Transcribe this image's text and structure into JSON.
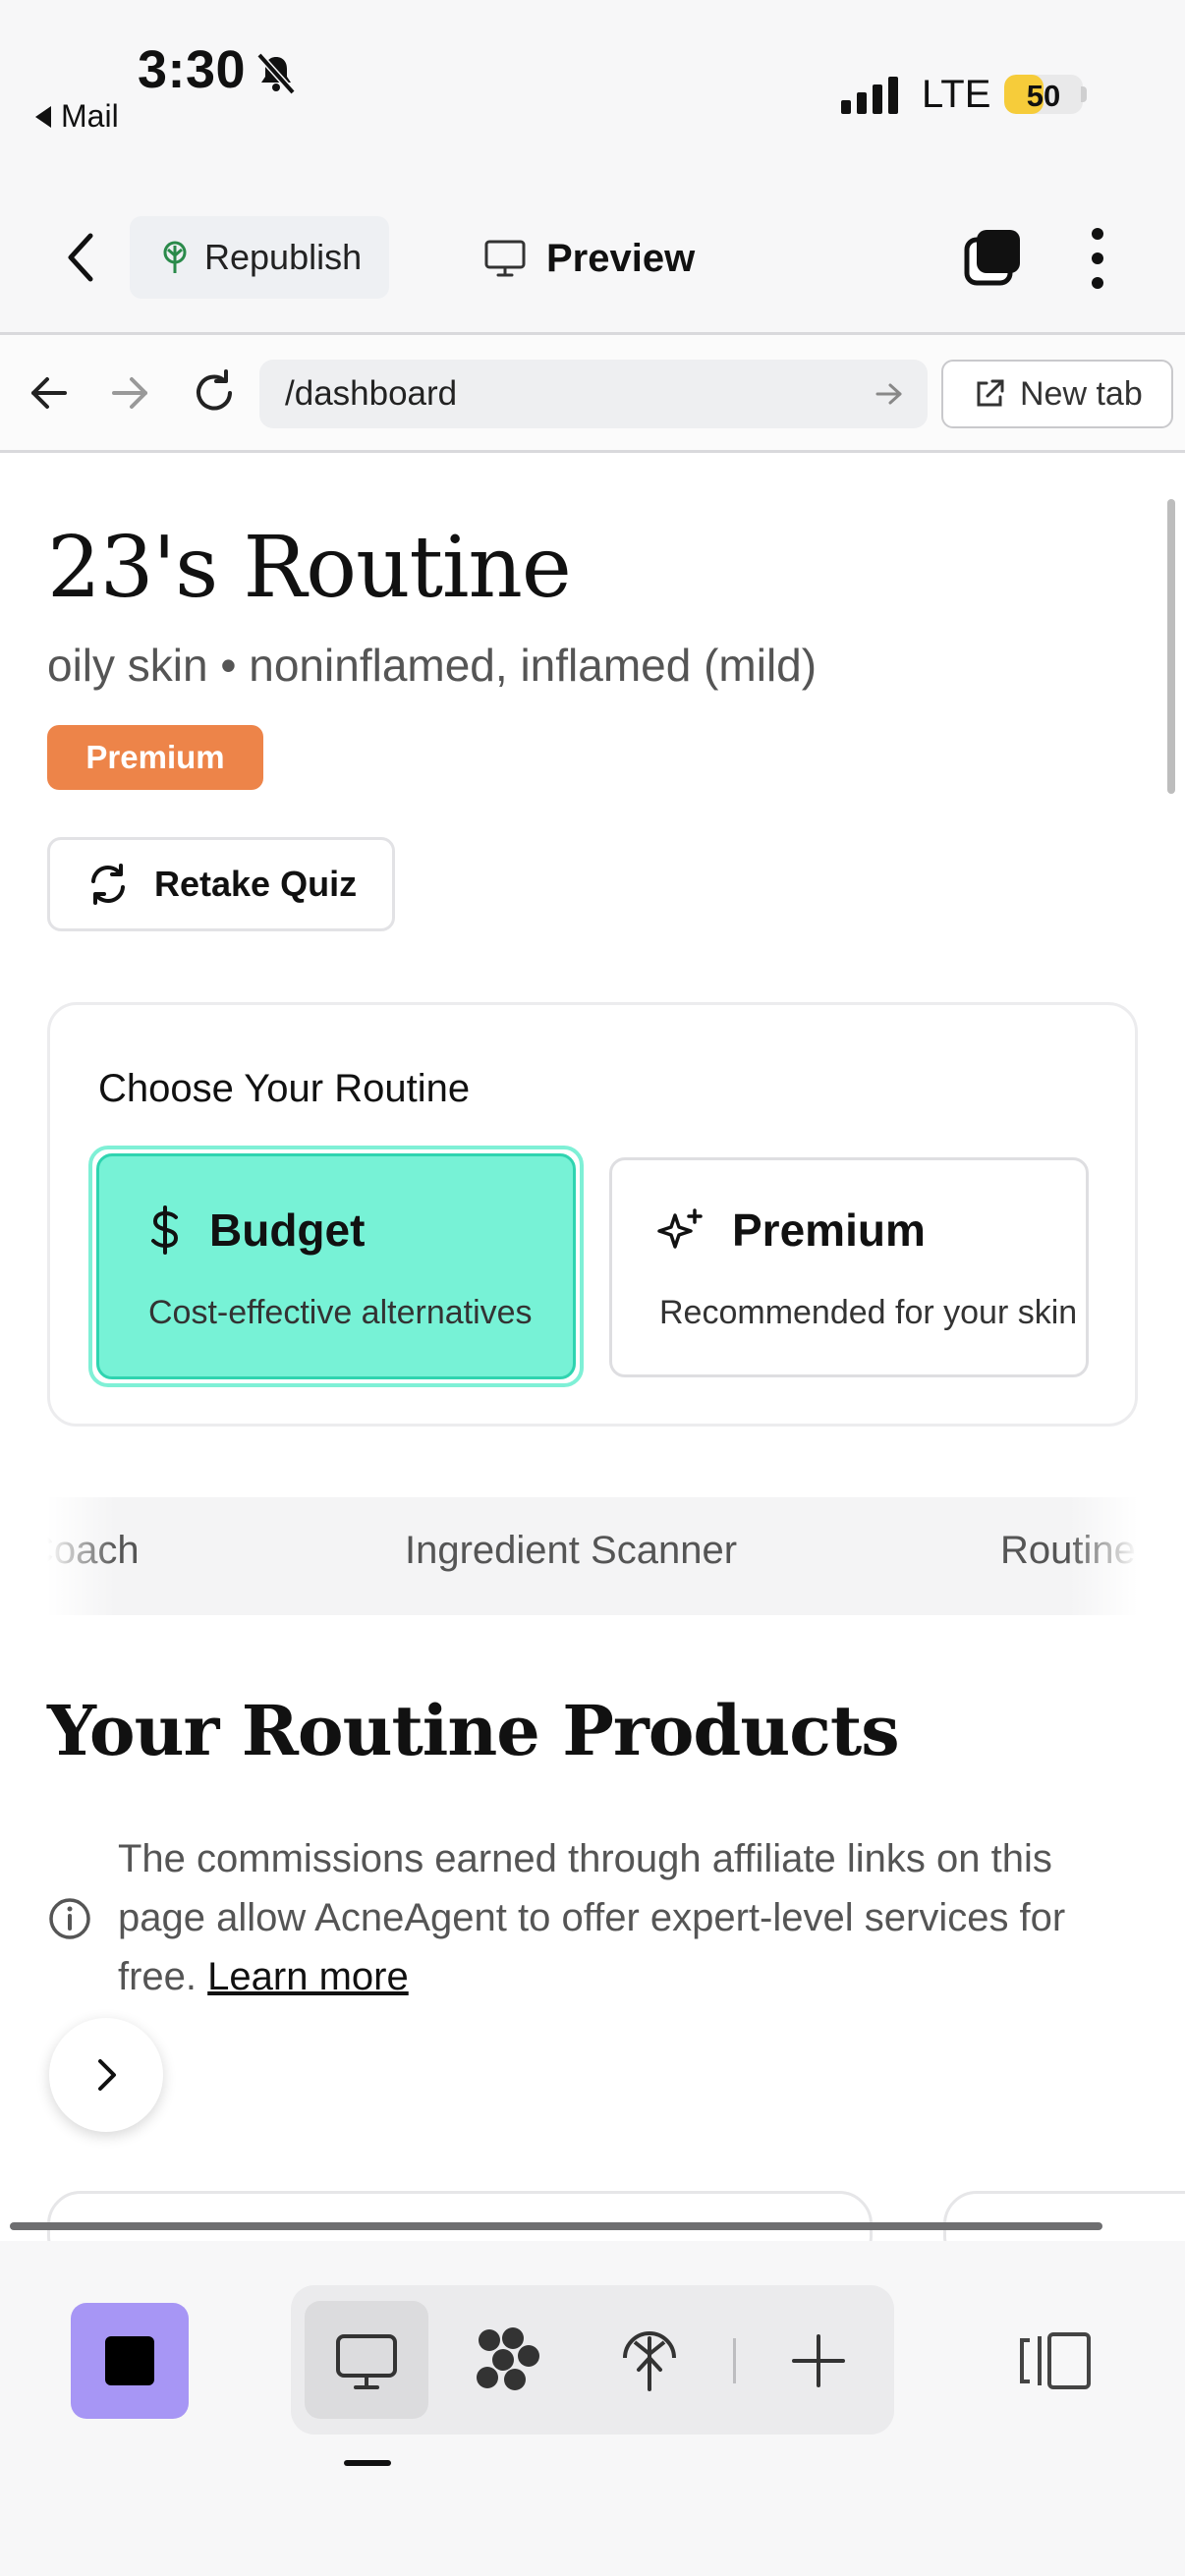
{
  "status_bar": {
    "time": "3:30",
    "back_app": "Mail",
    "network": "LTE",
    "battery": "50",
    "battery_level": 0.5
  },
  "topbar": {
    "republish_label": "Republish",
    "preview_label": "Preview"
  },
  "urlbar": {
    "url": "/dashboard",
    "new_tab_label": "New tab"
  },
  "page": {
    "title": "23's Routine",
    "subtitle": "oily skin • noninflamed, inflamed (mild)",
    "badge": "Premium",
    "retake_label": "Retake Quiz",
    "routine_chooser": {
      "heading": "Choose Your Routine",
      "options": [
        {
          "title": "Budget",
          "desc": "Cost-effective alternatives",
          "selected": true
        },
        {
          "title": "Premium",
          "desc": "Recommended for your skin",
          "selected": false
        }
      ]
    },
    "tabs": [
      "Coach",
      "Ingredient Scanner",
      "Routine"
    ],
    "products_title": "Your Routine Products",
    "affiliate_text": "The commissions earned through affiliate links on this page allow AcneAgent to offer expert-level services for free.",
    "learn_more": "Learn more"
  },
  "colors": {
    "accent_budget": "#77f2d6",
    "premium_badge": "#ed8449",
    "app_icon": "#a796f5"
  }
}
